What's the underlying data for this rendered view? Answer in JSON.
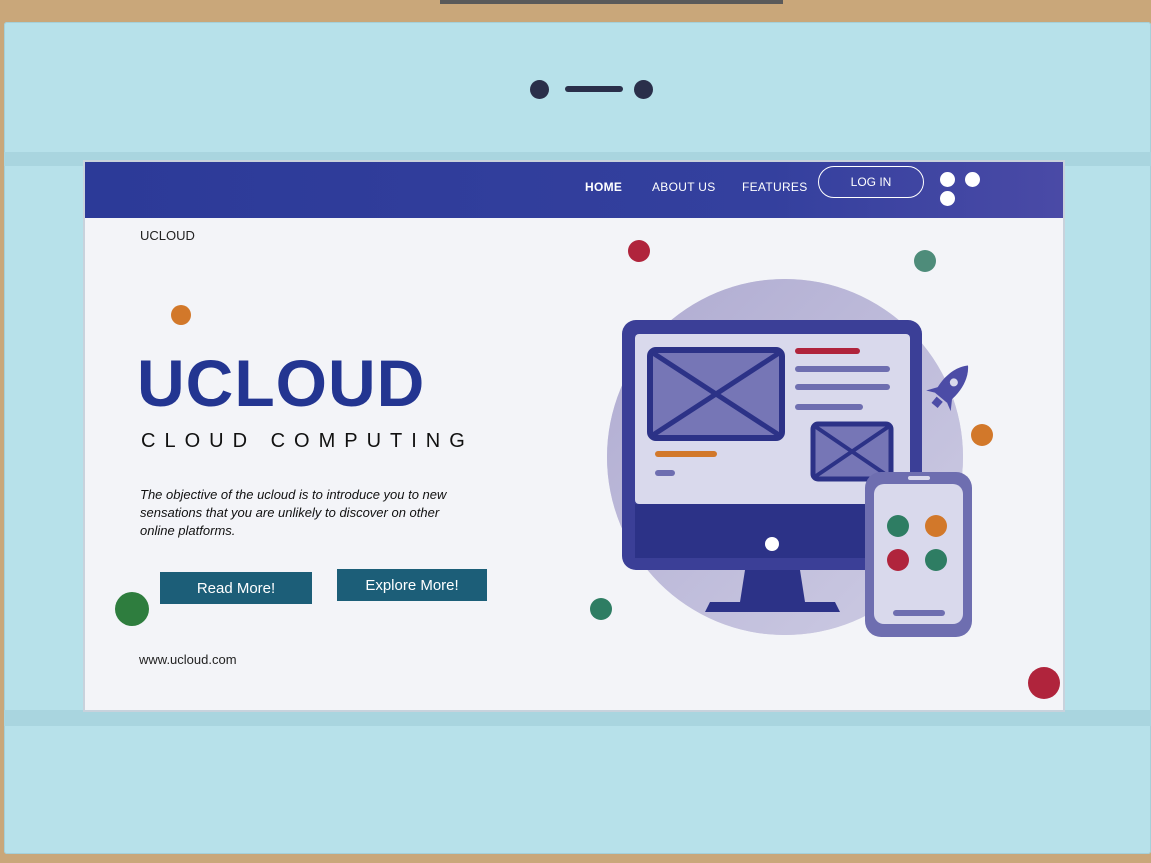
{
  "nav": {
    "home": "HOME",
    "about": "ABOUT US",
    "features": "FEATURES",
    "login": "LOG IN"
  },
  "brand": "UCLOUD",
  "hero": {
    "title": "UCLOUD",
    "subtitle": "CLOUD COMPUTING",
    "description": "The objective of the ucloud is to introduce you to new sensations that you are unlikely to discover on other online platforms.",
    "read_more": "Read More!",
    "explore_more": "Explore More!"
  },
  "footer": {
    "website": "www.ucloud.com"
  },
  "colors": {
    "nav_bg": "#2c3a98",
    "title": "#233591",
    "button": "#1c5e78",
    "frame": "#b7e1ea",
    "dot_red": "#b0243c",
    "dot_green": "#2e7d63",
    "dot_orange": "#d2782a"
  },
  "icons": [
    "camera-icon",
    "more-dots-icon",
    "monitor-icon",
    "phone-icon",
    "rocket-icon",
    "image-placeholder-icon"
  ]
}
